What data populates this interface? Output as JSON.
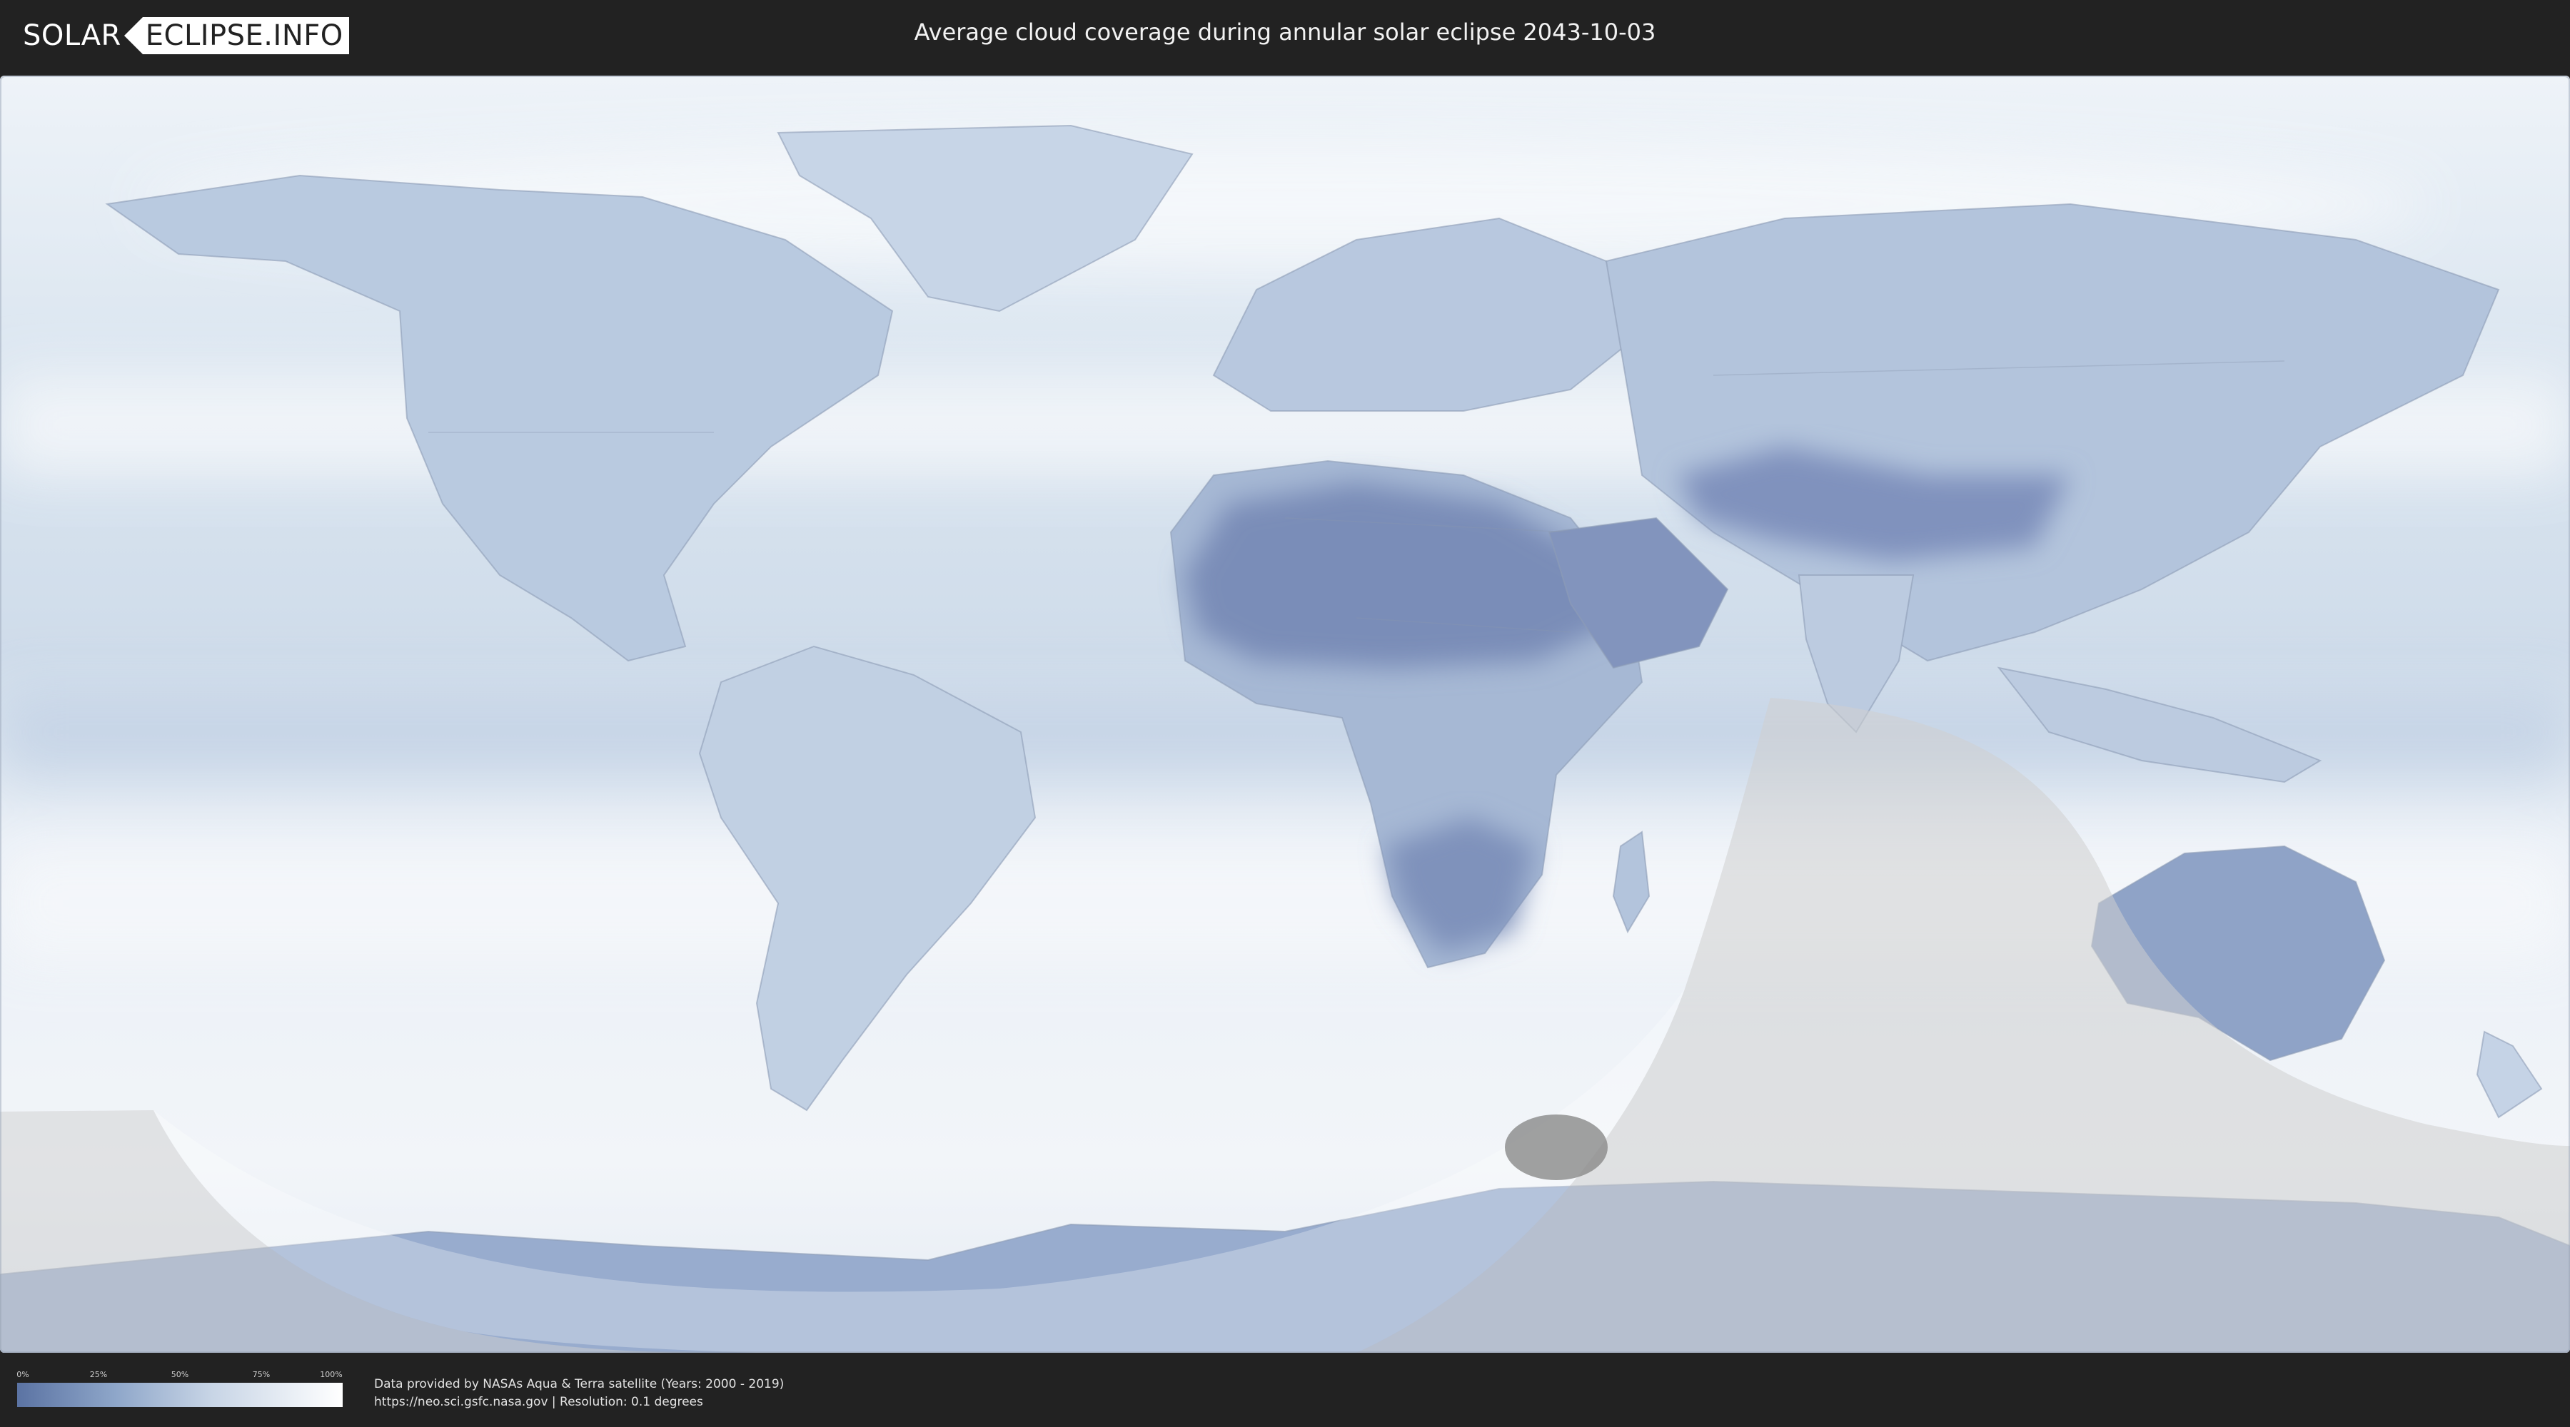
{
  "header": {
    "logo_left": "SOLAR",
    "logo_right": "ECLIPSE.INFO",
    "title": "Average cloud coverage during annular solar eclipse 2043-10-03"
  },
  "map": {
    "ocean_color": "#dfe8f2",
    "land_color": "#a9bdd8",
    "dry_land_color": "#7689b6",
    "shadow_color": "#cfcfcf"
  },
  "legend": {
    "ticks": [
      "0%",
      "25%",
      "50%",
      "75%",
      "100%"
    ],
    "gradient": [
      "#5b73a3",
      "#8ea6c9",
      "#c8d5e6",
      "#ffffff"
    ]
  },
  "credits": {
    "line1": "Data provided by NASAs Aqua & Terra satellite (Years: 2000 - 2019)",
    "line2": "https://neo.sci.gsfc.nasa.gov | Resolution: 0.1 degrees"
  }
}
